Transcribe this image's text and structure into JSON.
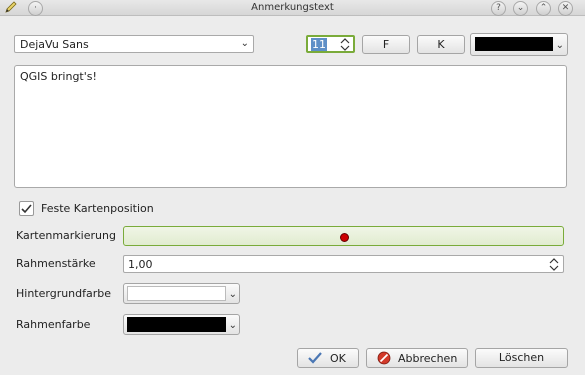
{
  "window": {
    "title": "Anmerkungstext"
  },
  "font_bar": {
    "font_family": "DejaVu Sans",
    "font_size": "11",
    "bold_label": "F",
    "italic_label": "K",
    "text_color": "#000000"
  },
  "editor": {
    "text": "QGIS bringt's!"
  },
  "fixed_position": {
    "label": "Feste Kartenposition",
    "checked": true
  },
  "fields": {
    "marker_label": "Kartenmarkierung",
    "marker_color": "#cc0000",
    "frame_width_label": "Rahmenstärke",
    "frame_width_value": "1,00",
    "bg_color_label": "Hintergrundfarbe",
    "bg_color_value": "#ffffff",
    "frame_color_label": "Rahmenfarbe",
    "frame_color_value": "#000000"
  },
  "buttons": {
    "ok": "OK",
    "cancel": "Abbrechen",
    "delete": "Löschen"
  },
  "colors": {
    "accent_green": "#7aab3a"
  }
}
